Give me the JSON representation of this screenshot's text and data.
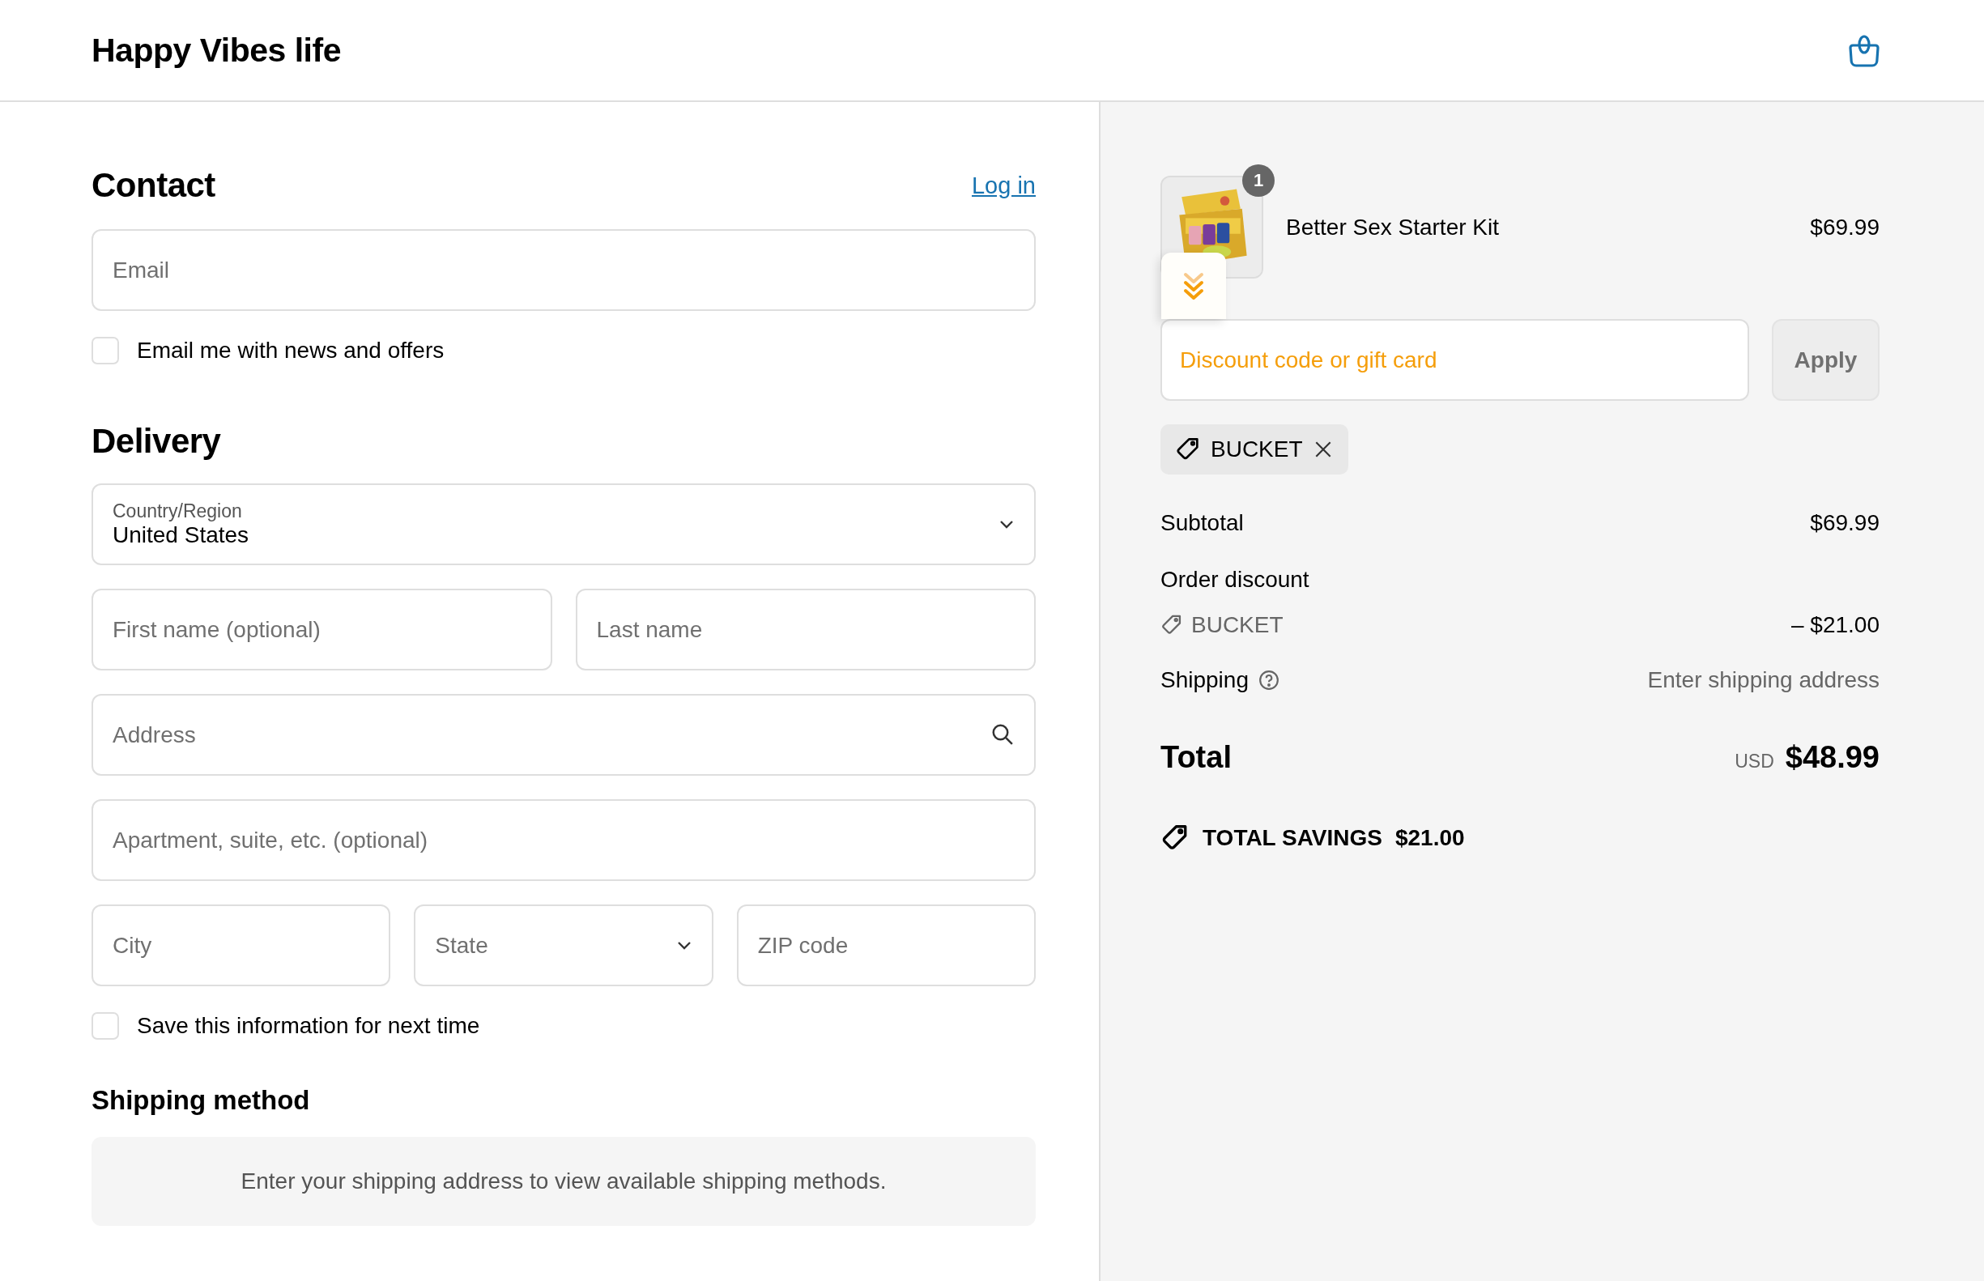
{
  "header": {
    "store_name": "Happy Vibes life"
  },
  "contact": {
    "heading": "Contact",
    "login_link": "Log in",
    "email": {
      "placeholder": "Email"
    },
    "newsletter": {
      "label": "Email me with news and offers",
      "checked": false
    }
  },
  "delivery": {
    "heading": "Delivery",
    "country": {
      "label": "Country/Region",
      "value": "United States"
    },
    "first_name": {
      "placeholder": "First name (optional)"
    },
    "last_name": {
      "placeholder": "Last name"
    },
    "address": {
      "placeholder": "Address"
    },
    "apartment": {
      "placeholder": "Apartment, suite, etc. (optional)"
    },
    "city": {
      "placeholder": "City"
    },
    "state": {
      "placeholder": "State"
    },
    "zip": {
      "placeholder": "ZIP code"
    },
    "save_info": {
      "label": "Save this information for next time",
      "checked": false
    }
  },
  "shipping_method": {
    "heading": "Shipping method",
    "notice": "Enter your shipping address to view available shipping methods."
  },
  "summary": {
    "items": [
      {
        "name": "Better Sex Starter Kit",
        "quantity": "1",
        "price": "$69.99"
      }
    ],
    "discount_field": {
      "placeholder": "Discount code or gift card"
    },
    "apply_button": {
      "label": "Apply",
      "disabled": true
    },
    "applied_codes": [
      {
        "code": "BUCKET"
      }
    ],
    "subtotal": {
      "label": "Subtotal",
      "value": "$69.99"
    },
    "order_discount": {
      "label": "Order discount",
      "code": "BUCKET",
      "value": "– $21.00"
    },
    "shipping": {
      "label": "Shipping",
      "value": "Enter shipping address"
    },
    "total": {
      "label": "Total",
      "currency": "USD",
      "value": "$48.99"
    },
    "savings": {
      "label": "TOTAL SAVINGS",
      "value": "$21.00"
    }
  }
}
